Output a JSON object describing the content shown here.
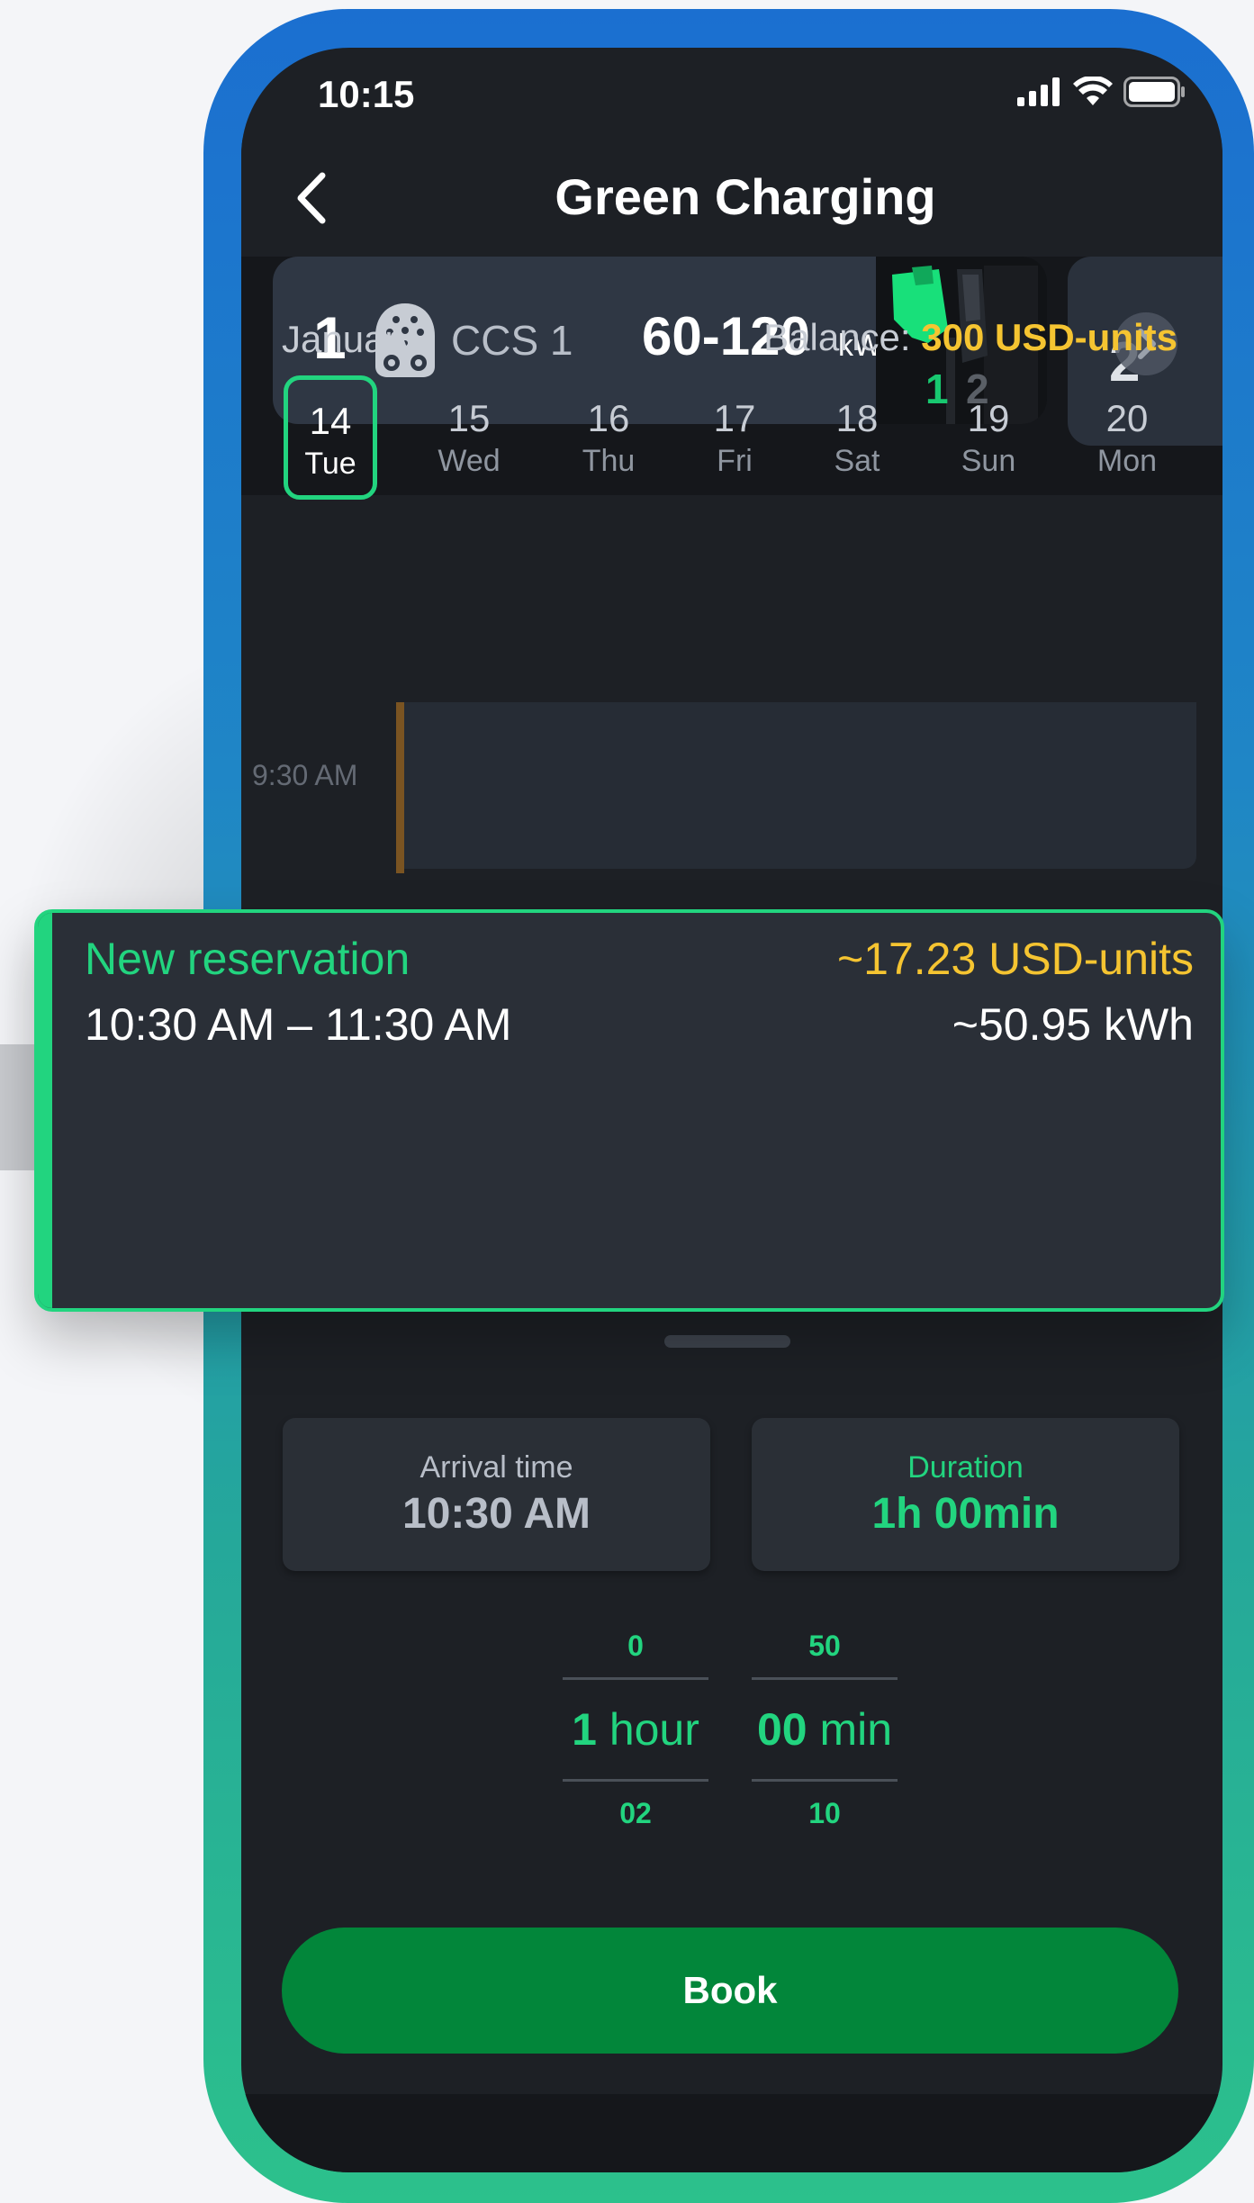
{
  "status_bar": {
    "time": "10:15"
  },
  "header": {
    "title": "Green Charging"
  },
  "connectors": [
    {
      "number": "1",
      "type": "CCS 1",
      "power": "60-120",
      "unit": "kW",
      "photo_labels": [
        "1",
        "2"
      ]
    },
    {
      "number": "2"
    }
  ],
  "calendar": {
    "month": "January",
    "balance_label": "Balance:",
    "balance_value": "300 USD-units",
    "days": [
      {
        "num": "14",
        "name": "Tue",
        "selected": true
      },
      {
        "num": "15",
        "name": "Wed"
      },
      {
        "num": "16",
        "name": "Thu"
      },
      {
        "num": "17",
        "name": "Fri"
      },
      {
        "num": "18",
        "name": "Sat"
      },
      {
        "num": "19",
        "name": "Sun"
      },
      {
        "num": "20",
        "name": "Mon"
      }
    ]
  },
  "timeline": {
    "time_label": "9:30 AM"
  },
  "reservation": {
    "title": "New reservation",
    "time_range": "10:30 AM – 11:30 AM",
    "price": "~17.23 USD-units",
    "energy": "~50.95 kWh"
  },
  "arrival": {
    "label": "Arrival time",
    "value": "10:30 AM"
  },
  "duration": {
    "label": "Duration",
    "value": "1h 00min"
  },
  "picker": {
    "hours": {
      "prev": "0",
      "current_num": "1",
      "current_unit": "hour",
      "next": "02"
    },
    "minutes": {
      "prev": "50",
      "current_num": "00",
      "current_unit": "min",
      "next": "10"
    }
  },
  "book_button": {
    "label": "Book"
  },
  "colors": {
    "accent_green": "#22d47f",
    "balance_yellow": "#f5c431",
    "button_green": "#02863a"
  }
}
